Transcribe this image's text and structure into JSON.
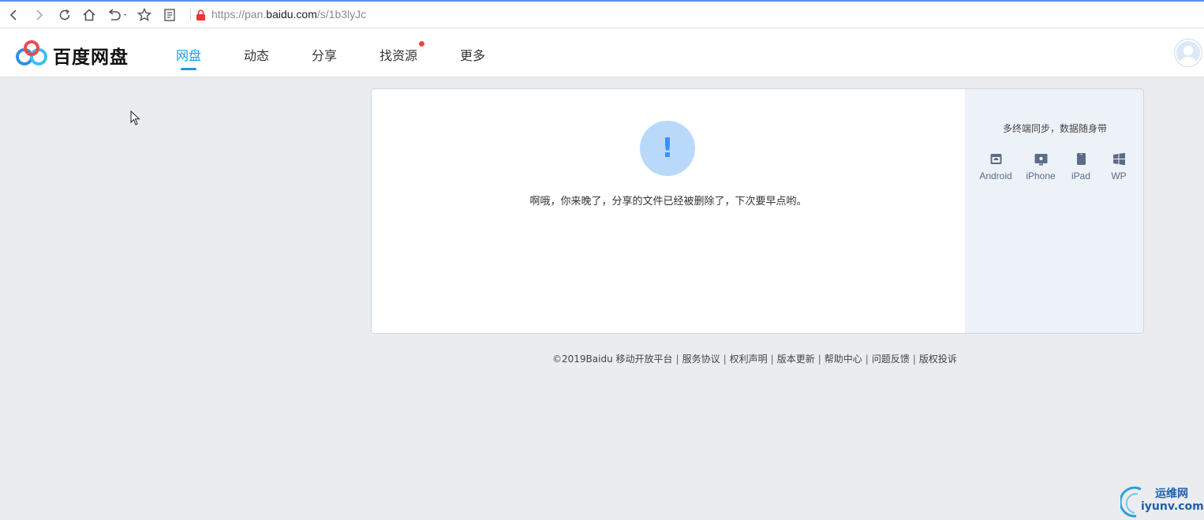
{
  "browser": {
    "url_prefix": "https://pan.",
    "url_domain": "baidu.com",
    "url_path": "/s/1b3lyJc"
  },
  "header": {
    "brand": "百度网盘",
    "nav": [
      {
        "label": "网盘",
        "active": true
      },
      {
        "label": "动态",
        "active": false
      },
      {
        "label": "分享",
        "active": false
      },
      {
        "label": "找资源",
        "active": false,
        "badge": "red-dot"
      },
      {
        "label": "更多",
        "active": false
      }
    ]
  },
  "notice": {
    "icon": "exclamation-icon",
    "message": "啊哦，你来晚了，分享的文件已经被删除了，下次要早点哟。"
  },
  "sidebar": {
    "title": "多终端同步，数据随身带",
    "devices": [
      {
        "label": "Android",
        "icon": "android-icon"
      },
      {
        "label": "iPhone",
        "icon": "iphone-icon"
      },
      {
        "label": "iPad",
        "icon": "ipad-icon"
      },
      {
        "label": "WP",
        "icon": "windows-icon"
      }
    ]
  },
  "footer": {
    "copyright": "©2019Baidu",
    "links": [
      "移动开放平台",
      "服务协议",
      "权利声明",
      "版本更新",
      "帮助中心",
      "问题反馈",
      "版权投诉"
    ]
  },
  "watermark": {
    "name": "运维网",
    "domain": "iyunv.com"
  },
  "colors": {
    "accent": "#1f9ae0",
    "notice_circle": "#b9d9fb",
    "notice_mark": "#3e8ff3",
    "badge": "#f0453d",
    "page_bg": "#ebecef"
  }
}
